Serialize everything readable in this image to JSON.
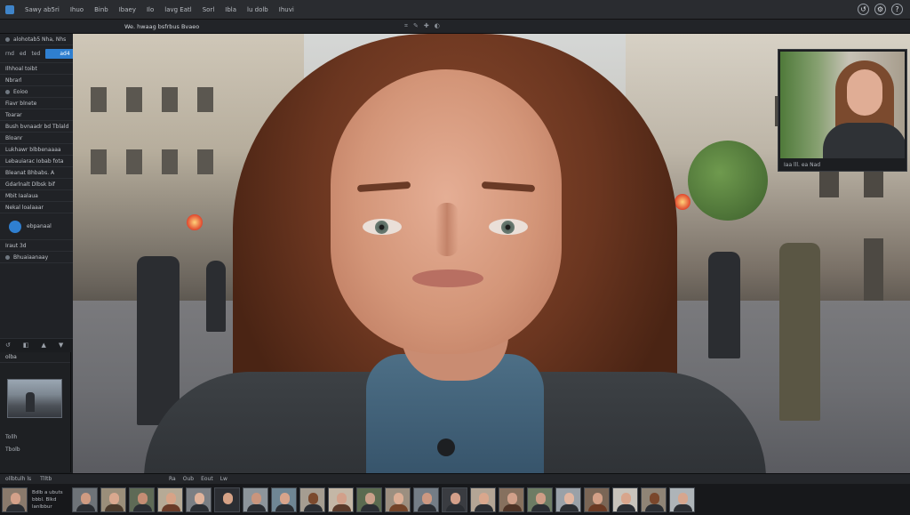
{
  "menubar": {
    "items": [
      "Sawy ab5ri",
      "Ihuo",
      "Binb",
      "Ibaey",
      "Ilo",
      "lavg Eatl",
      "Sorl",
      "Ibla",
      "lu dolb",
      "Ihuvi"
    ]
  },
  "toolbar": {
    "title": "We. hwaag bsfrbus Bvaeo"
  },
  "left_panel": {
    "header": "alohotab5 Nha, Nhs",
    "tabs": [
      "rnd",
      "ed",
      "ted",
      "ad4"
    ],
    "rows": [
      "Ilhhoal toibt",
      "Nbrarl",
      "Eoioo",
      "Fiavr blnete",
      "Toarar",
      "Bush bvnaadr bd Tblald",
      "Bloanr",
      "Lukhawr blbbenaaaa",
      "Lebauiarac Iobab fota",
      "Bleanat Bhbabs. A",
      "Gdarlnalt Dlbsk bif",
      "Mbit Iaalaua",
      "Nekal loalaaar",
      "ebpanaal",
      "Iraut 3d",
      "Bhuaiaanaay"
    ]
  },
  "navigator": {
    "title": "olba",
    "rows": [
      "Tollh",
      "Tbolb"
    ]
  },
  "preview": {
    "caption": "Iaa lll. ea Nad"
  },
  "filmstrip": {
    "bar_left": "ollbtulh ls",
    "bar_right": "Tlltb",
    "bar_center": [
      "Ra",
      "Oub",
      "Eout",
      "Lw"
    ],
    "info": [
      "Bdlb a ubuts",
      "bbbl. Blkd lanlbbur"
    ]
  },
  "colors": {
    "accent": "#2f7fd0",
    "chrome": "#202226"
  }
}
